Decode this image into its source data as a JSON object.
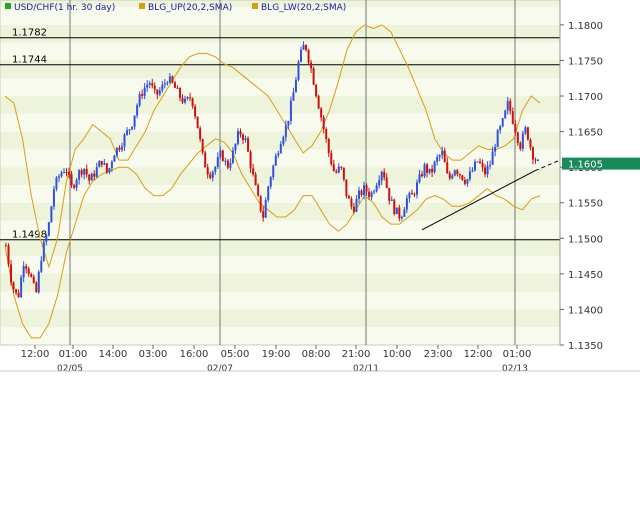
{
  "chart_data": {
    "type": "candlestick",
    "legend": [
      {
        "label": "USD/CHF(1 hr. 30 day)",
        "color": "#2e9e2e"
      },
      {
        "label": "BLG_UP(20,2,SMA)",
        "color": "#d4a017"
      },
      {
        "label": "BLG_LW(20,2,SMA)",
        "color": "#d4a017"
      }
    ],
    "ylim": [
      1.135,
      1.1835
    ],
    "y_ticks": [
      "1.1350",
      "1.1400",
      "1.1450",
      "1.1500",
      "1.1550",
      "1.1600",
      "1.1650",
      "1.1700",
      "1.1750",
      "1.1800"
    ],
    "x_ticks": [
      "12:00",
      "01:00",
      "14:00",
      "03:00",
      "16:00",
      "05:00",
      "19:00",
      "08:00",
      "21:00",
      "10:00",
      "23:00",
      "12:00",
      "01:00"
    ],
    "date_labels": [
      "02/05",
      "02/07",
      "02/11",
      "02/13"
    ],
    "horizontal_lines": [
      {
        "label": "1.1782",
        "value": 1.1782
      },
      {
        "label": "1.1744",
        "value": 1.1744
      },
      {
        "label": "1.1498",
        "value": 1.1498
      }
    ],
    "last_price": {
      "label": "1.1605",
      "value": 1.1605
    },
    "trendline": {
      "from": [
        0.745,
        1.1512
      ],
      "to": [
        0.975,
        1.1595
      ],
      "extend_to": [
        1.0,
        1.161
      ]
    },
    "price_path": [
      1.149,
      1.1435,
      1.1415,
      1.147,
      1.145,
      1.142,
      1.148,
      1.151,
      1.157,
      1.159,
      1.16,
      1.157,
      1.159,
      1.16,
      1.158,
      1.1595,
      1.161,
      1.159,
      1.162,
      1.163,
      1.1645,
      1.166,
      1.169,
      1.171,
      1.172,
      1.17,
      1.171,
      1.1725,
      1.1715,
      1.17,
      1.169,
      1.17,
      1.166,
      1.161,
      1.159,
      1.16,
      1.162,
      1.16,
      1.162,
      1.165,
      1.164,
      1.16,
      1.156,
      1.153,
      1.158,
      1.161,
      1.164,
      1.166,
      1.17,
      1.175,
      1.1775,
      1.174,
      1.17,
      1.166,
      1.162,
      1.159,
      1.16,
      1.156,
      1.154,
      1.156,
      1.157,
      1.156,
      1.158,
      1.16,
      1.156,
      1.154,
      1.153,
      1.1555,
      1.156,
      1.158,
      1.16,
      1.159,
      1.161,
      1.162,
      1.158,
      1.16,
      1.159,
      1.158,
      1.1595,
      1.161,
      1.159,
      1.1605,
      1.164,
      1.166,
      1.169,
      1.166,
      1.163,
      1.1655,
      1.162,
      1.1605
    ],
    "upper_band": [
      1.17,
      1.169,
      1.164,
      1.156,
      1.15,
      1.146,
      1.15,
      1.158,
      1.1625,
      1.164,
      1.166,
      1.165,
      1.164,
      1.161,
      1.161,
      1.163,
      1.165,
      1.168,
      1.17,
      1.172,
      1.174,
      1.1755,
      1.176,
      1.176,
      1.1755,
      1.1745,
      1.174,
      1.173,
      1.172,
      1.171,
      1.17,
      1.168,
      1.166,
      1.164,
      1.162,
      1.163,
      1.165,
      1.168,
      1.172,
      1.1765,
      1.179,
      1.18,
      1.1795,
      1.18,
      1.179,
      1.1765,
      1.174,
      1.171,
      1.168,
      1.164,
      1.162,
      1.161,
      1.161,
      1.162,
      1.163,
      1.1625,
      1.1625,
      1.163,
      1.164,
      1.168,
      1.17,
      1.169
    ],
    "lower_band": [
      1.149,
      1.142,
      1.138,
      1.136,
      1.136,
      1.138,
      1.142,
      1.148,
      1.152,
      1.156,
      1.158,
      1.159,
      1.1595,
      1.16,
      1.16,
      1.159,
      1.157,
      1.156,
      1.156,
      1.157,
      1.159,
      1.1605,
      1.162,
      1.163,
      1.164,
      1.1635,
      1.162,
      1.159,
      1.157,
      1.155,
      1.154,
      1.153,
      1.153,
      1.154,
      1.156,
      1.156,
      1.154,
      1.152,
      1.151,
      1.152,
      1.154,
      1.156,
      1.155,
      1.153,
      1.152,
      1.152,
      1.153,
      1.154,
      1.1555,
      1.156,
      1.1555,
      1.1545,
      1.1545,
      1.155,
      1.156,
      1.157,
      1.156,
      1.1555,
      1.1545,
      1.154,
      1.1555,
      1.156
    ]
  }
}
